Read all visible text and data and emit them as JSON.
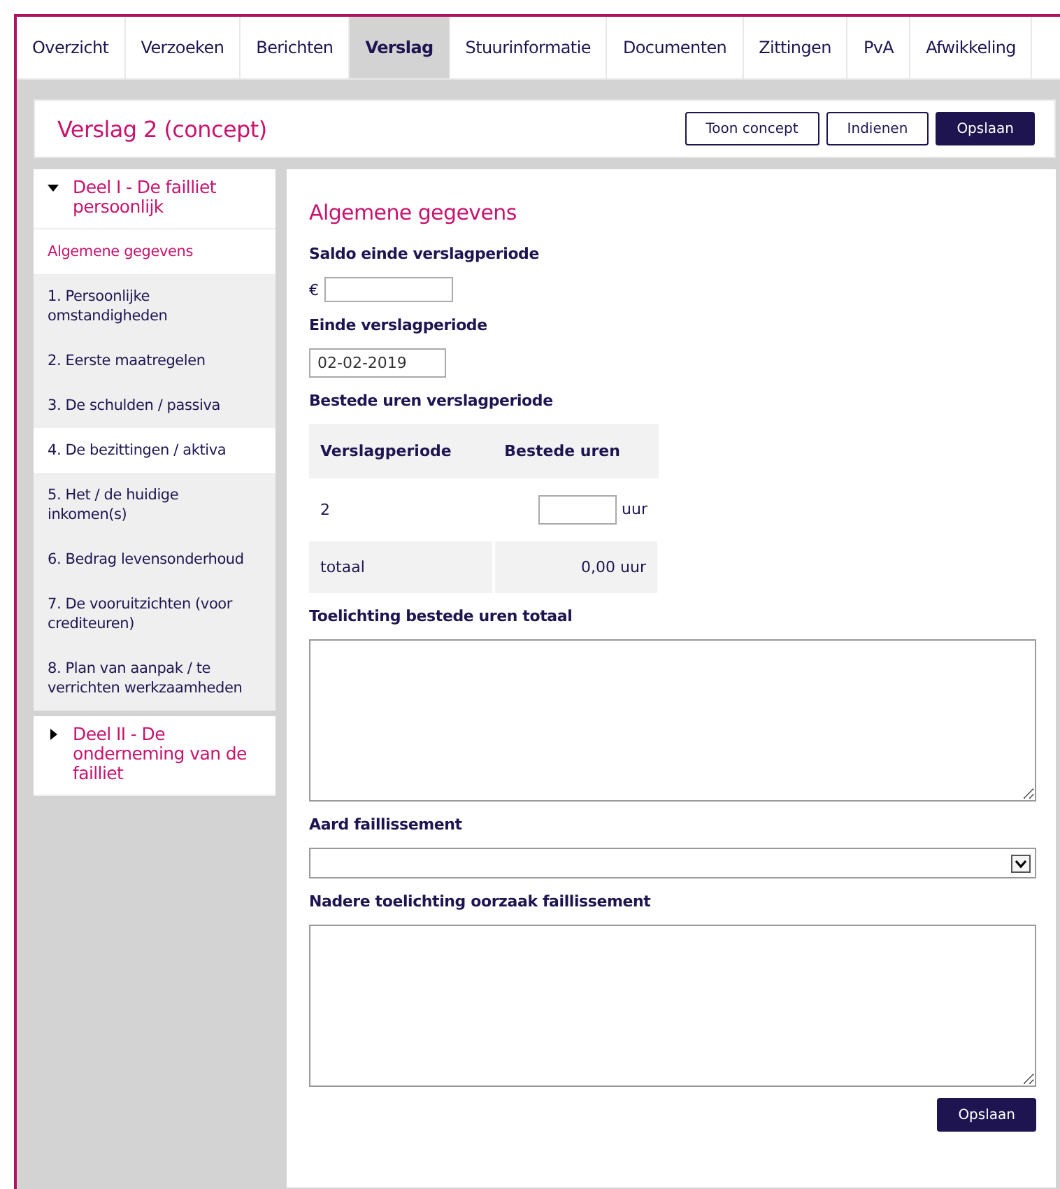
{
  "tabs": [
    {
      "label": "Overzicht",
      "selected": false
    },
    {
      "label": "Verzoeken",
      "selected": false
    },
    {
      "label": "Berichten",
      "selected": false
    },
    {
      "label": "Verslag",
      "selected": true
    },
    {
      "label": "Stuurinformatie",
      "selected": false
    },
    {
      "label": "Documenten",
      "selected": false
    },
    {
      "label": "Zittingen",
      "selected": false
    },
    {
      "label": "PvA",
      "selected": false
    },
    {
      "label": "Afwikkeling",
      "selected": false
    }
  ],
  "header": {
    "title": "Verslag 2 (concept)",
    "buttons": [
      {
        "label": "Toon concept",
        "kind": "secondary"
      },
      {
        "label": "Indienen",
        "kind": "secondary"
      },
      {
        "label": "Opslaan",
        "kind": "primary"
      }
    ]
  },
  "sidebar": {
    "sections": [
      {
        "title": "Deel I - De failliet persoonlijk",
        "expanded": true,
        "items": [
          {
            "label": "Algemene gegevens",
            "selected": true,
            "hovered": false
          },
          {
            "label": "1. Persoonlijke omstandigheden",
            "selected": false,
            "hovered": false
          },
          {
            "label": "2. Eerste maatregelen",
            "selected": false,
            "hovered": false
          },
          {
            "label": "3. De schulden / passiva",
            "selected": false,
            "hovered": false
          },
          {
            "label": "4. De bezittingen / aktiva",
            "selected": false,
            "hovered": true
          },
          {
            "label": "5. Het / de huidige inkomen(s)",
            "selected": false,
            "hovered": false
          },
          {
            "label": "6. Bedrag levensonderhoud",
            "selected": false,
            "hovered": false
          },
          {
            "label": "7. De vooruitzichten (voor crediteuren)",
            "selected": false,
            "hovered": false
          },
          {
            "label": "8. Plan van aanpak / te verrichten werkzaamheden",
            "selected": false,
            "hovered": false
          }
        ]
      },
      {
        "title": "Deel II - De onderneming van de failliet",
        "expanded": false
      }
    ]
  },
  "form": {
    "title": "Algemene gegevens",
    "saldo": {
      "label": "Saldo einde verslagperiode",
      "currency": "€"
    },
    "einde": {
      "label": "Einde verslagperiode",
      "value": "02-02-2019"
    },
    "uren": {
      "label": "Bestede uren verslagperiode",
      "columns": [
        "Verslagperiode",
        "Bestede uren"
      ],
      "row": {
        "period": "2",
        "unit": "uur"
      },
      "total": {
        "label": "totaal",
        "value": "0,00 uur"
      }
    },
    "toelichting": {
      "label": "Toelichting bestede uren totaal"
    },
    "aard": {
      "label": "Aard faillissement"
    },
    "oorzaak": {
      "label": "Nadere toelichting oorzaak faillissement"
    },
    "save": "Opslaan"
  }
}
